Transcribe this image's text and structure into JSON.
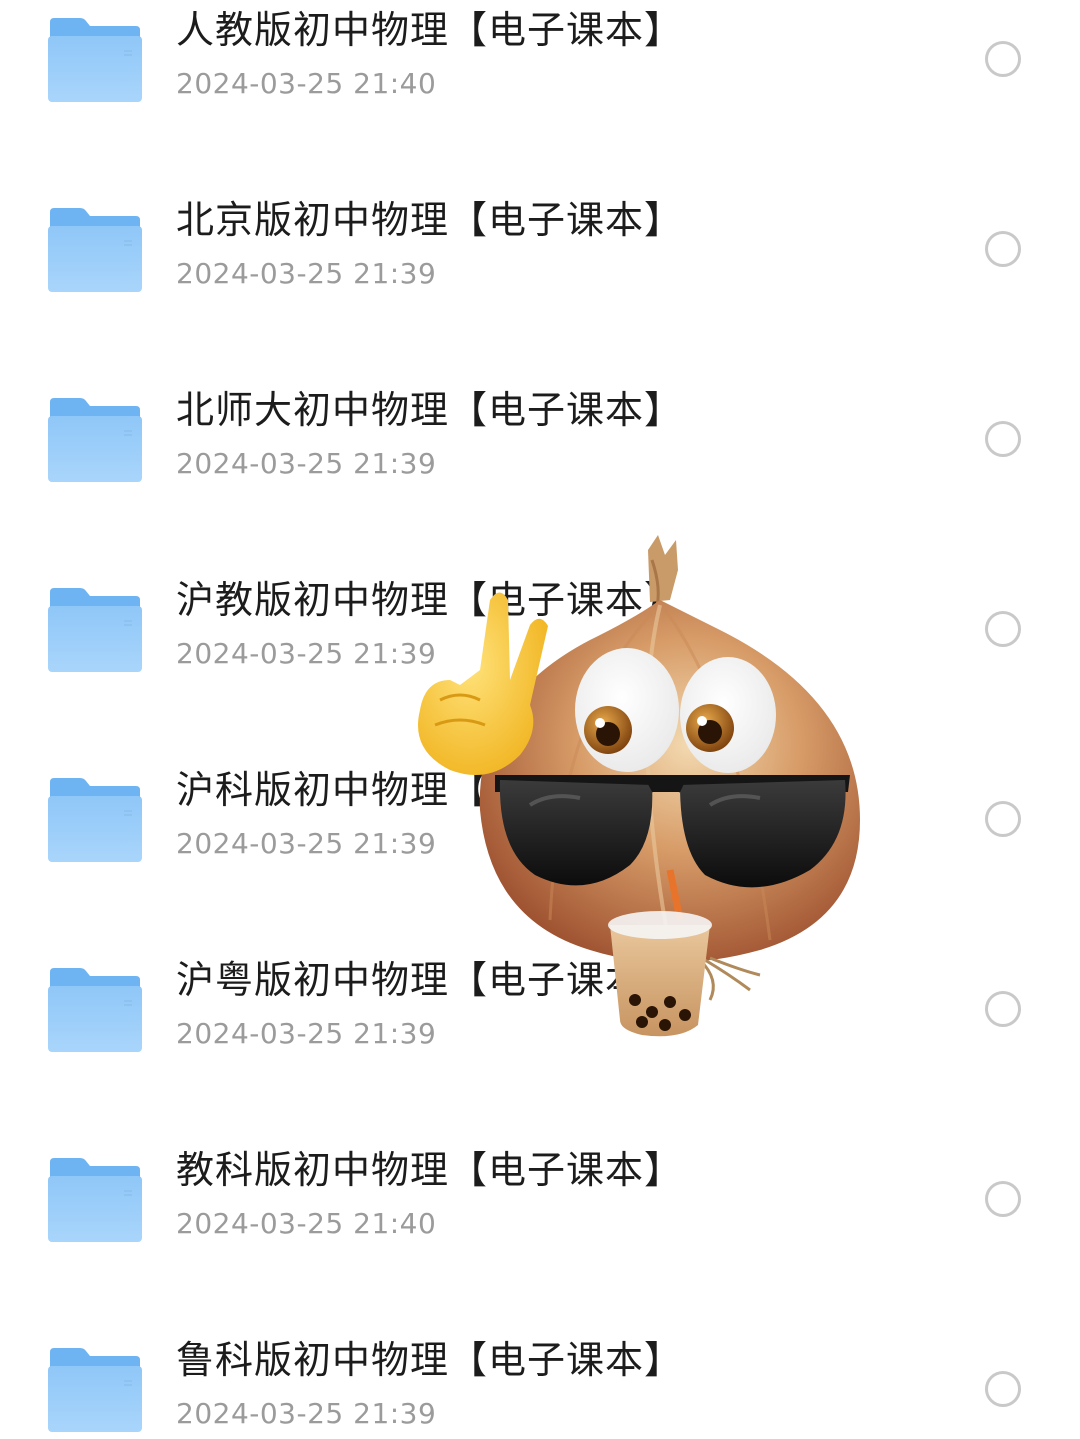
{
  "file_list": {
    "items": [
      {
        "name": "人教版初中物理【电子课本】",
        "date": "2024-03-25 21:40"
      },
      {
        "name": "北京版初中物理【电子课本】",
        "date": "2024-03-25 21:39"
      },
      {
        "name": "北师大初中物理【电子课本】",
        "date": "2024-03-25 21:39"
      },
      {
        "name": "沪教版初中物理【电子课本】",
        "date": "2024-03-25 21:39"
      },
      {
        "name": "沪科版初中物理【电子课本】",
        "date": "2024-03-25 21:39"
      },
      {
        "name": "沪粤版初中物理【电子课本】",
        "date": "2024-03-25 21:39"
      },
      {
        "name": "教科版初中物理【电子课本】",
        "date": "2024-03-25 21:40"
      },
      {
        "name": "鲁科版初中物理【电子课本】",
        "date": "2024-03-25 21:39"
      }
    ],
    "icon": "folder-icon",
    "selection_icon": "radio-unchecked-icon"
  },
  "overlay": {
    "icon": "onion-sunglasses-sticker"
  },
  "colors": {
    "folder_light": "#a8d4fb",
    "folder_dark": "#6fb4f2",
    "title_text": "#1c1c1c",
    "date_text": "#9b9b9b",
    "radio_border": "#c9c9c9"
  }
}
